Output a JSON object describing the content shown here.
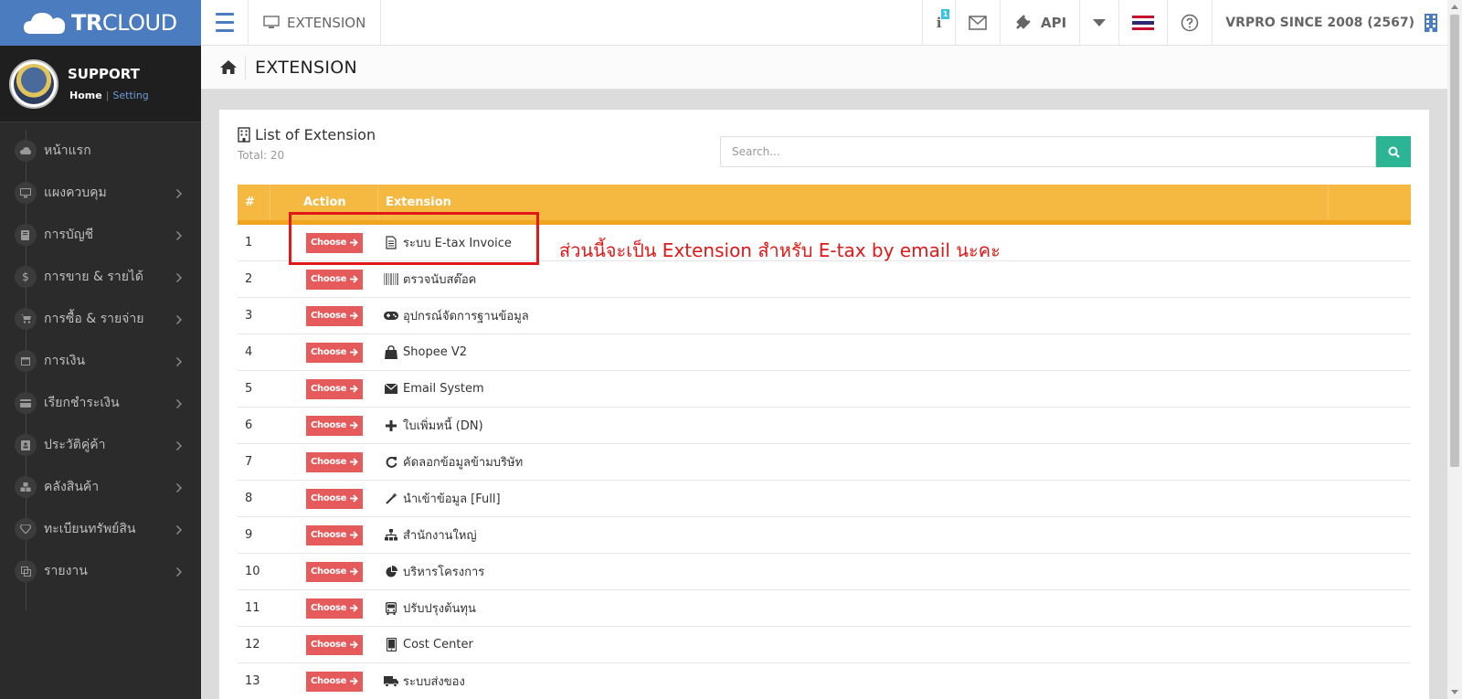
{
  "brand": {
    "tr": "TR",
    "cloud": "CLOUD"
  },
  "profile": {
    "name": "SUPPORT",
    "home": "Home",
    "separator": "|",
    "setting": "Setting"
  },
  "sidebar": {
    "items": [
      {
        "label": "หน้าแรก",
        "icon": "cloud-icon",
        "has_arrow": false
      },
      {
        "label": "แผงควบคุม",
        "icon": "monitor-icon",
        "has_arrow": true
      },
      {
        "label": "การบัญชี",
        "icon": "book-icon",
        "has_arrow": true
      },
      {
        "label": "การขาย & รายได้",
        "icon": "dollar-icon",
        "has_arrow": true
      },
      {
        "label": "การซื้อ & รายจ่าย",
        "icon": "cart-icon",
        "has_arrow": true
      },
      {
        "label": "การเงิน",
        "icon": "calendar-icon",
        "has_arrow": true
      },
      {
        "label": "เรียกชำระเงิน",
        "icon": "credit-card-icon",
        "has_arrow": true
      },
      {
        "label": "ประวัติคู่ค้า",
        "icon": "contact-book-icon",
        "has_arrow": true
      },
      {
        "label": "คลังสินค้า",
        "icon": "cubes-icon",
        "has_arrow": true
      },
      {
        "label": "ทะเบียนทรัพย์สิน",
        "icon": "diamond-icon",
        "has_arrow": true
      },
      {
        "label": "รายงาน",
        "icon": "copy-icon",
        "has_arrow": true
      }
    ]
  },
  "topbar": {
    "section": "EXTENSION",
    "info_badge": "1",
    "api_label": "API",
    "company": "VRPRO SINCE 2008 (2567)"
  },
  "page": {
    "title": "EXTENSION"
  },
  "panel": {
    "title": "List of Extension",
    "total": "Total: 20",
    "search_placeholder": "Search..."
  },
  "table": {
    "headers": {
      "num": "#",
      "action": "Action",
      "extension": "Extension"
    },
    "choose_label": "Choose",
    "rows": [
      {
        "num": "1",
        "name": "ระบบ E-tax Invoice",
        "icon": "file-text-icon"
      },
      {
        "num": "2",
        "name": "ตรวจนับสต๊อค",
        "icon": "barcode-icon"
      },
      {
        "num": "3",
        "name": "อุปกรณ์จัดการฐานข้อมูล",
        "icon": "gamepad-icon"
      },
      {
        "num": "4",
        "name": "Shopee V2",
        "icon": "shopping-bag-icon"
      },
      {
        "num": "5",
        "name": "Email System",
        "icon": "envelope-icon"
      },
      {
        "num": "6",
        "name": "ใบเพิ่มหนี้ (DN)",
        "icon": "plus-icon"
      },
      {
        "num": "7",
        "name": "คัดลอกข้อมูลข้ามบริษัท",
        "icon": "refresh-icon"
      },
      {
        "num": "8",
        "name": "นำเข้าข้อมูล [Full]",
        "icon": "magic-wand-icon"
      },
      {
        "num": "9",
        "name": "สำนักงานใหญ่",
        "icon": "sitemap-icon"
      },
      {
        "num": "10",
        "name": "บริหารโครงการ",
        "icon": "pie-chart-icon"
      },
      {
        "num": "11",
        "name": "ปรับปรุงต้นทุน",
        "icon": "bus-icon"
      },
      {
        "num": "12",
        "name": "Cost Center",
        "icon": "tablet-icon"
      },
      {
        "num": "13",
        "name": "ระบบส่งของ",
        "icon": "truck-icon"
      }
    ]
  },
  "annotation": {
    "text": "ส่วนนี้จะเป็น Extension สำหรับ E-tax by email นะคะ"
  },
  "colors": {
    "brand_blue": "#4a7cbf",
    "sidebar_bg": "#2b2b2b",
    "table_header": "#f5b942",
    "choose_button": "#e55a5a",
    "search_button": "#2bb594",
    "annotation_red": "#e01818"
  }
}
